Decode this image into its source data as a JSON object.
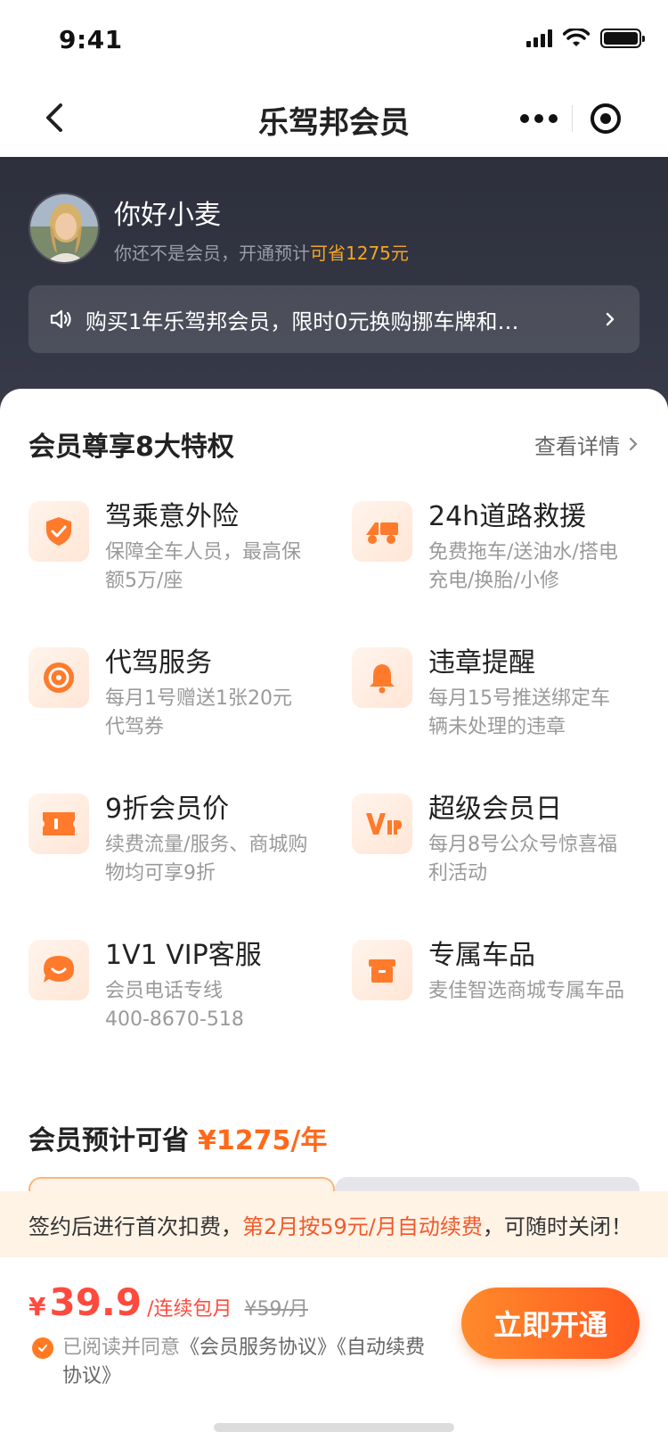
{
  "status": {
    "time": "9:41"
  },
  "nav": {
    "title": "乐驾邦会员"
  },
  "user": {
    "greeting": "你好小麦",
    "sub_text": "你还不是会员，开通预计",
    "sub_highlight": "可省1275元"
  },
  "notice": {
    "text": "购买1年乐驾邦会员，限时0元换购挪车牌和…"
  },
  "privileges": {
    "title": "会员尊享8大特权",
    "more": "查看详情",
    "items": [
      {
        "title": "驾乘意外险",
        "desc": "保障全车人员，最高保额5万/座",
        "icon": "shield-check-icon"
      },
      {
        "title": "24h道路救援",
        "desc": "免费拖车/送油水/搭电充电/换胎/小修",
        "icon": "tow-truck-icon"
      },
      {
        "title": "代驾服务",
        "desc": "每月1号赠送1张20元代驾券",
        "icon": "steering-wheel-icon"
      },
      {
        "title": "违章提醒",
        "desc": "每月15号推送绑定车辆未处理的违章",
        "icon": "bell-icon"
      },
      {
        "title": "9折会员价",
        "desc": "续费流量/服务、商城购物均可享9折",
        "icon": "ticket-icon"
      },
      {
        "title": "超级会员日",
        "desc": "每月8号公众号惊喜福利活动",
        "icon": "vip-icon"
      },
      {
        "title": "1V1 VIP客服",
        "desc": "会员电话专线\n400-8670-518",
        "icon": "chat-bubble-icon"
      },
      {
        "title": "专属车品",
        "desc": "麦佳智选商城专属车品",
        "icon": "gift-box-icon"
      }
    ]
  },
  "savings": {
    "label": "会员预计可省",
    "amount": "¥1275/年"
  },
  "tip": {
    "part1": "签约后进行首次扣费，",
    "part2": "第2月按59元/月自动续费",
    "part3": "，可随时关闭！"
  },
  "purchase": {
    "currency": "¥",
    "price": "39.9",
    "unit": "/连续包月",
    "original": "¥59/月",
    "agree_prefix": "已阅读并同意",
    "agree_link1": "《会员服务协议》",
    "agree_link2": "《自动续费协议》",
    "cta": "立即开通"
  },
  "colors": {
    "accent": "#ff6a1a",
    "price_red": "#ff4a3d",
    "header_dark": "#2d2f3c"
  }
}
